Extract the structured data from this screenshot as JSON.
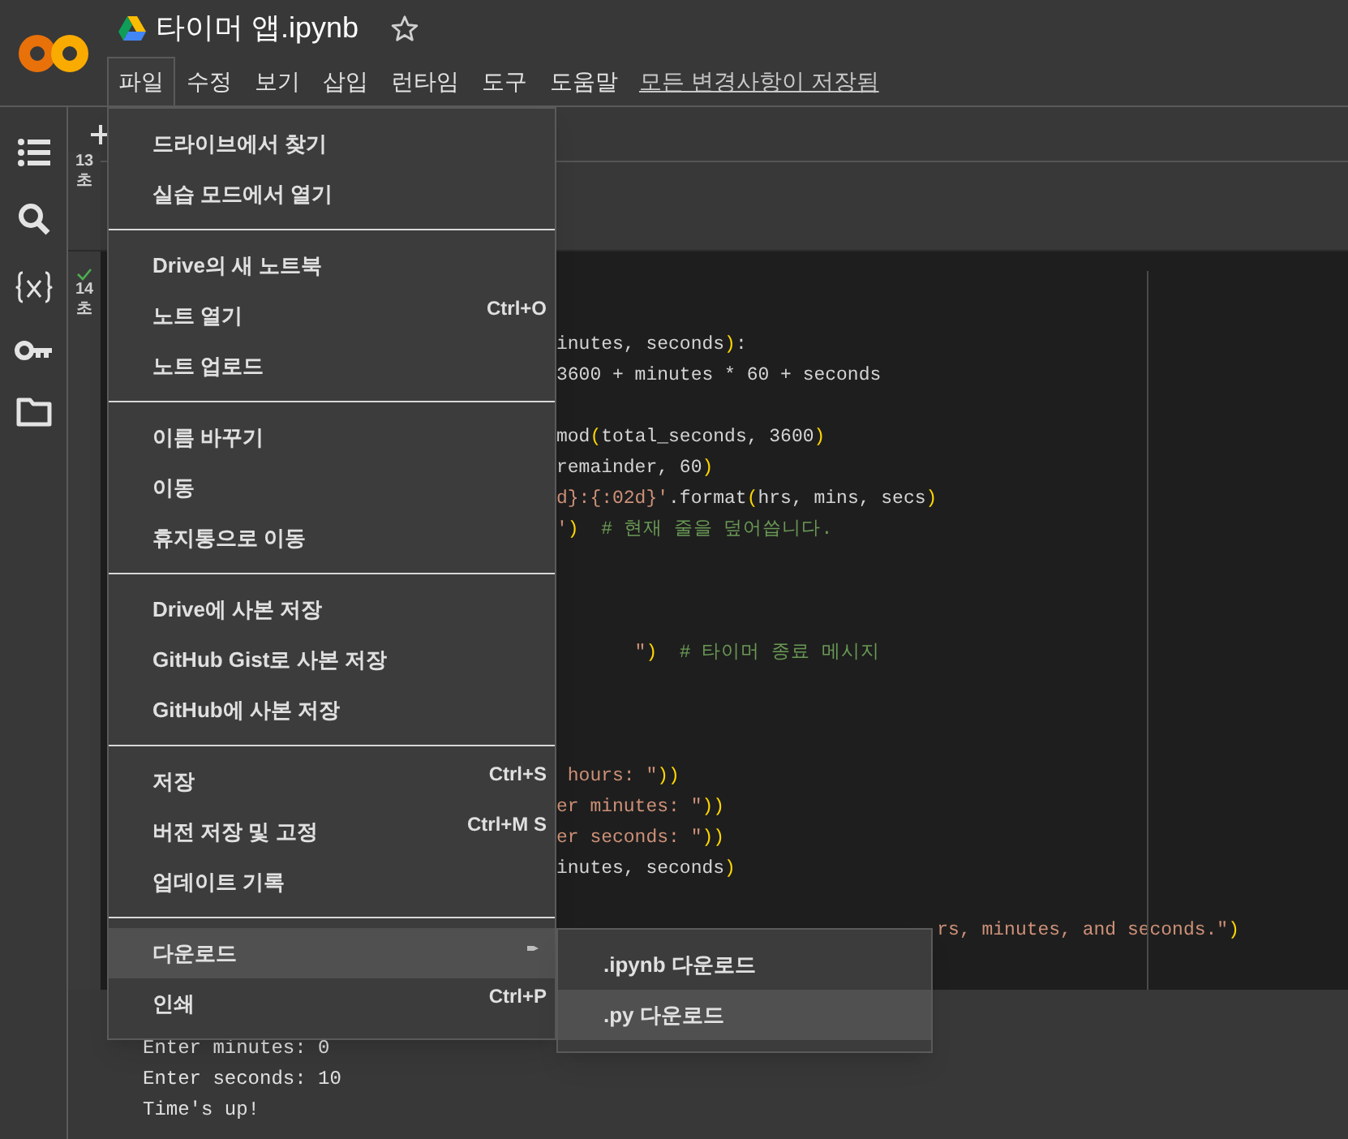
{
  "notebook": {
    "title": "타이머 앱.ipynb",
    "starred": false
  },
  "menu_bar": [
    {
      "label": "파일",
      "selected": true
    },
    {
      "label": "수정",
      "selected": false
    },
    {
      "label": "보기",
      "selected": false
    },
    {
      "label": "삽입",
      "selected": false
    },
    {
      "label": "런타임",
      "selected": false
    },
    {
      "label": "도구",
      "selected": false
    },
    {
      "label": "도움말",
      "selected": false
    }
  ],
  "save_status": "모든 변경사항이 저장됨",
  "cells": [
    {
      "time_value": "13",
      "time_unit": "초",
      "completed": false
    },
    {
      "time_value": "14",
      "time_unit": "초",
      "completed": true
    }
  ],
  "code_lines": [
    {
      "kind": "blank"
    },
    {
      "kind": "blank"
    },
    {
      "kind": "code",
      "segments": [
        {
          "text": "inutes, seconds",
          "kind": "plain"
        },
        {
          "text": ")",
          "kind": "bracket"
        },
        {
          "text": ":",
          "kind": "plain"
        }
      ]
    },
    {
      "kind": "code",
      "segments": [
        {
          "text": "3600 + minutes * 60 + seconds",
          "kind": "plain"
        }
      ]
    },
    {
      "kind": "blank"
    },
    {
      "kind": "code",
      "segments": [
        {
          "text": "mod",
          "kind": "plain"
        },
        {
          "text": "(",
          "kind": "bracket"
        },
        {
          "text": "total_seconds, 3600",
          "kind": "plain"
        },
        {
          "text": ")",
          "kind": "bracket"
        }
      ]
    },
    {
      "kind": "code",
      "segments": [
        {
          "text": "remainder, 60",
          "kind": "plain"
        },
        {
          "text": ")",
          "kind": "bracket"
        }
      ]
    },
    {
      "kind": "code",
      "segments": [
        {
          "text": "d}:{:02d}'",
          "kind": "string"
        },
        {
          "text": ".format",
          "kind": "plain"
        },
        {
          "text": "(",
          "kind": "bracket"
        },
        {
          "text": "hrs, mins, secs",
          "kind": "plain"
        },
        {
          "text": ")",
          "kind": "bracket"
        }
      ]
    },
    {
      "kind": "code",
      "segments": [
        {
          "text": "'",
          "kind": "string"
        },
        {
          "text": ")",
          "kind": "bracket"
        },
        {
          "text": "  # 현재 줄을 덮어씁니다.",
          "kind": "comment"
        }
      ]
    },
    {
      "kind": "blank"
    },
    {
      "kind": "blank"
    },
    {
      "kind": "blank"
    },
    {
      "kind": "code",
      "segments": [
        {
          "text": "       \"",
          "kind": "string"
        },
        {
          "text": ")",
          "kind": "bracket"
        },
        {
          "text": "  # 타이머 종료 메시지",
          "kind": "comment"
        }
      ]
    },
    {
      "kind": "blank"
    },
    {
      "kind": "blank"
    },
    {
      "kind": "blank"
    },
    {
      "kind": "code",
      "segments": [
        {
          "text": " hours: \"",
          "kind": "string"
        },
        {
          "text": "))",
          "kind": "bracket"
        }
      ]
    },
    {
      "kind": "code",
      "segments": [
        {
          "text": "er minutes: \"",
          "kind": "string"
        },
        {
          "text": "))",
          "kind": "bracket"
        }
      ]
    },
    {
      "kind": "code",
      "segments": [
        {
          "text": "er seconds: \"",
          "kind": "string"
        },
        {
          "text": "))",
          "kind": "bracket"
        }
      ]
    },
    {
      "kind": "code",
      "segments": [
        {
          "text": "inutes, seconds",
          "kind": "plain"
        },
        {
          "text": ")",
          "kind": "bracket"
        }
      ]
    },
    {
      "kind": "blank"
    },
    {
      "kind": "code",
      "segments": [
        {
          "text": "                                  rs, minutes, and seconds.\"",
          "kind": "string"
        },
        {
          "text": ")",
          "kind": "bracket"
        }
      ]
    }
  ],
  "output_lines": [
    "Enter minutes: 0",
    "Enter seconds: 10",
    "Time's up!"
  ],
  "file_menu": {
    "groups": [
      [
        {
          "label": "드라이브에서 찾기",
          "selected": false
        },
        {
          "label": "실습 모드에서 열기",
          "selected": false
        }
      ],
      [
        {
          "label": "Drive의 새 노트북",
          "selected": false
        },
        {
          "label": "노트 열기",
          "shortcut": "Ctrl+O",
          "selected": false
        },
        {
          "label": "노트 업로드",
          "selected": false
        }
      ],
      [
        {
          "label": "이름 바꾸기",
          "selected": false
        },
        {
          "label": "이동",
          "selected": false
        },
        {
          "label": "휴지통으로 이동",
          "selected": false
        }
      ],
      [
        {
          "label": "Drive에 사본 저장",
          "selected": false
        },
        {
          "label": "GitHub Gist로 사본 저장",
          "selected": false
        },
        {
          "label": "GitHub에 사본 저장",
          "selected": false
        }
      ],
      [
        {
          "label": "저장",
          "shortcut": "Ctrl+S",
          "selected": false
        },
        {
          "label": "버전 저장 및 고정",
          "shortcut": "Ctrl+M S",
          "selected": false
        },
        {
          "label": "업데이트 기록",
          "selected": false
        }
      ],
      [
        {
          "label": "다운로드",
          "has_submenu": true,
          "selected": true
        },
        {
          "label": "인쇄",
          "shortcut": "Ctrl+P",
          "selected": false
        }
      ]
    ]
  },
  "download_submenu": [
    {
      "label": ".ipynb 다운로드",
      "selected": false
    },
    {
      "label": ".py 다운로드",
      "selected": true
    }
  ]
}
